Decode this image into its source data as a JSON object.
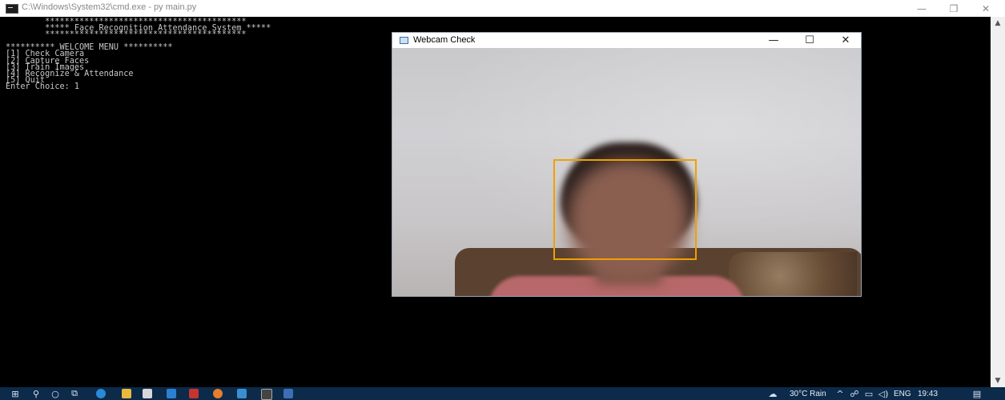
{
  "console": {
    "title": "C:\\Windows\\System32\\cmd.exe - py  main.py",
    "lines": [
      "        *****************************************",
      "        ***** Face Recognition Attendance System *****",
      "        *****************************************",
      "",
      "********** WELCOME MENU **********",
      "[1] Check Camera",
      "[2] Capture Faces",
      "[3] Train Images",
      "[4] Recognize & Attendance",
      "[5] Quit",
      "Enter Choice: 1"
    ]
  },
  "webcam_window": {
    "title": "Webcam Check",
    "minimize_glyph": "—",
    "maximize_glyph": "☐",
    "close_glyph": "✕"
  },
  "colors": {
    "face_box": "#f0a000",
    "taskbar": "#0c2a4a"
  },
  "taskbar": {
    "weather": "30°C Rain",
    "language": "ENG",
    "time": "19:43"
  }
}
